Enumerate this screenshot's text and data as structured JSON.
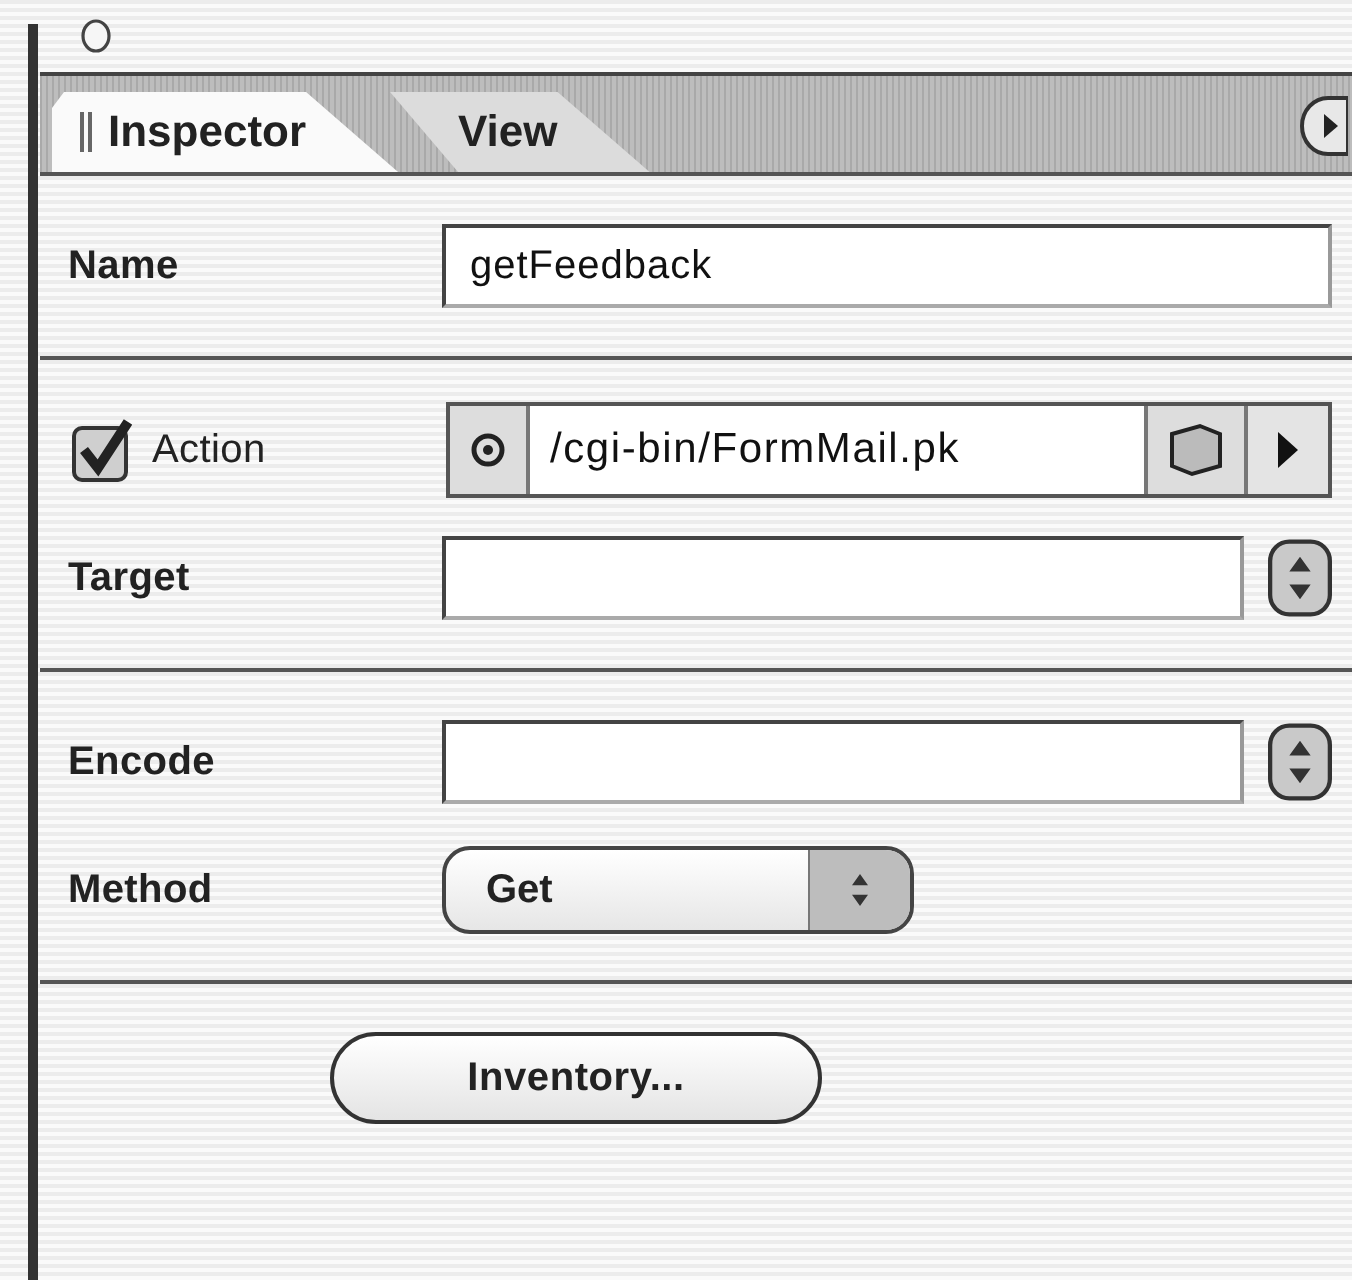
{
  "tabs": [
    {
      "label": "Inspector",
      "selected": true
    },
    {
      "label": "View",
      "selected": false
    }
  ],
  "sections": [
    {
      "rows": [
        {
          "kind": "text",
          "label": "Name",
          "value": "getFeedback"
        }
      ]
    },
    {
      "rows": [
        {
          "kind": "action",
          "label": "Action",
          "checked": true,
          "value": "/cgi-bin/FormMail.pk"
        },
        {
          "kind": "combo",
          "label": "Target"
        }
      ]
    },
    {
      "rows": [
        {
          "kind": "combo",
          "label": "Encode"
        },
        {
          "kind": "popup",
          "label": "Method",
          "value": "Get"
        }
      ]
    }
  ],
  "buttons": [
    "Inventory..."
  ]
}
